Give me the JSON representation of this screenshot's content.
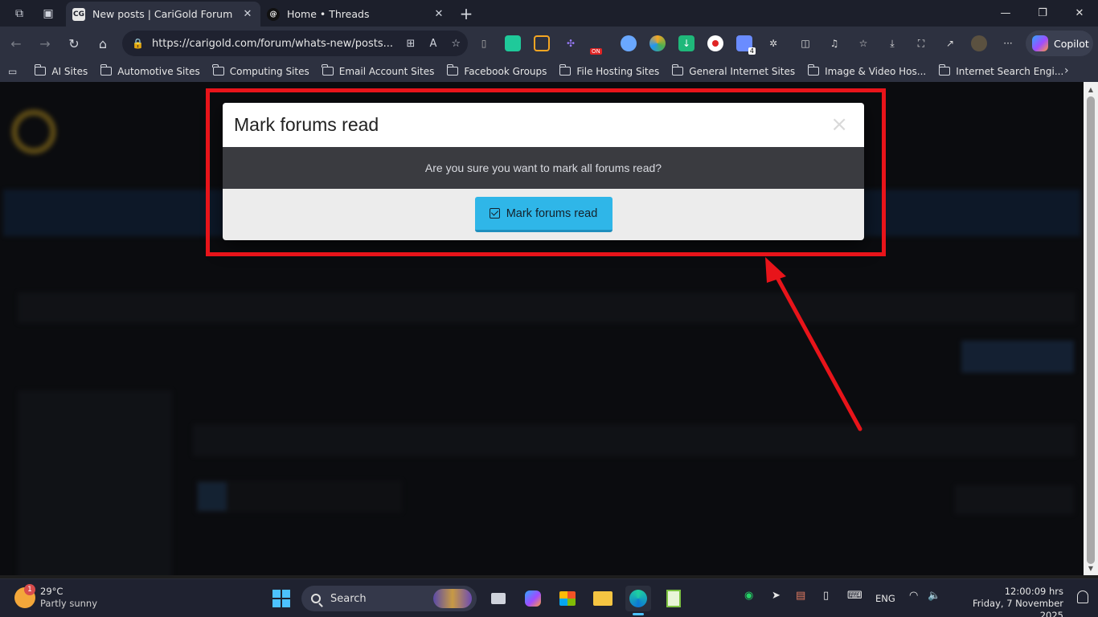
{
  "browser": {
    "tabs": [
      {
        "title": "New posts | CariGold Forum",
        "favicon": "CG"
      },
      {
        "title": "Home • Threads",
        "favicon": "@"
      }
    ],
    "url": "https://carigold.com/forum/whats-new/posts...",
    "copilot_label": "Copilot",
    "ext_badge_on": "ON",
    "ext_badge_count": "4"
  },
  "bookmarks": [
    "AI Sites",
    "Automotive Sites",
    "Computing Sites",
    "Email Account Sites",
    "Facebook Groups",
    "File Hosting Sites",
    "General Internet Sites",
    "Image & Video Hos...",
    "Internet Search Engi..."
  ],
  "modal": {
    "title": "Mark forums read",
    "message": "Are you sure you want to mark all forums read?",
    "confirm_label": "Mark forums read",
    "close_glyph": "×"
  },
  "taskbar": {
    "weather_temp": "29°C",
    "weather_desc": "Partly sunny",
    "weather_badge": "1",
    "search_label": "Search",
    "lang": "ENG",
    "time": "12:00:09 hrs",
    "date": "Friday, 7 November 2025"
  },
  "colors": {
    "annotation_red": "#e8141a",
    "primary_button": "#2fb6e8",
    "modal_body": "#3a3b40"
  }
}
